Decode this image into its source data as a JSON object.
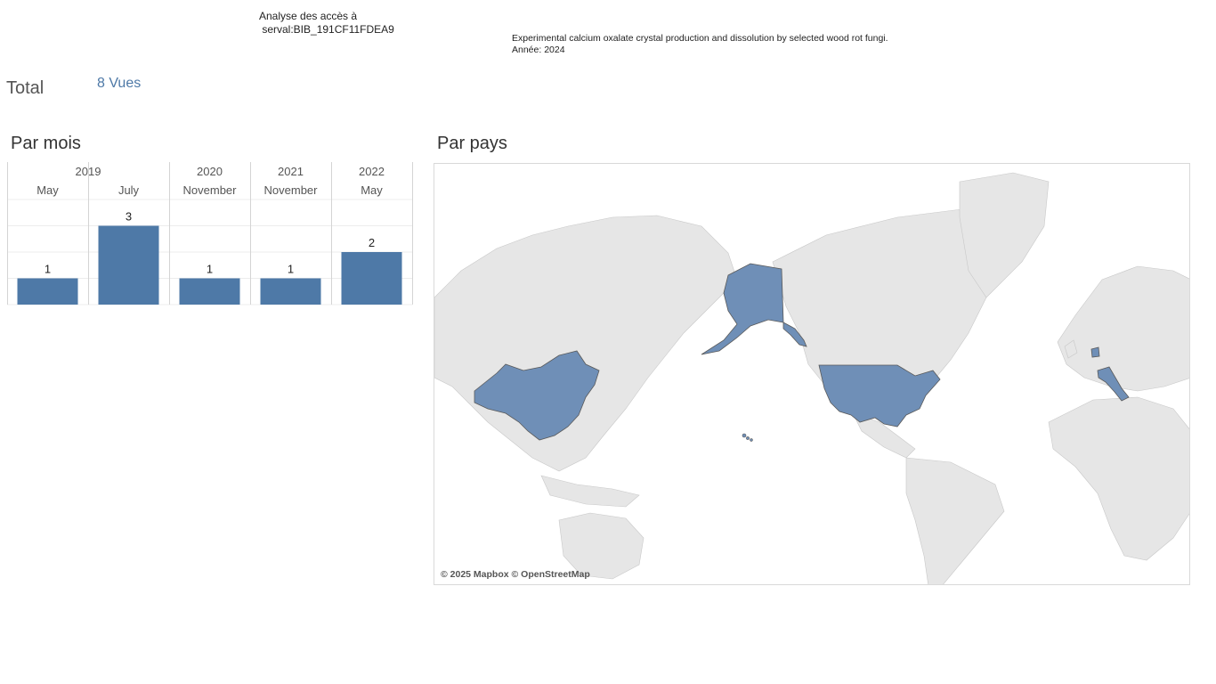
{
  "header": {
    "title": "Analyse des accès à\n serval:BIB_191CF11FDEA9",
    "publication": "Experimental calcium oxalate crystal production and dissolution by selected wood rot fungi.",
    "year_line": "Année: 2024"
  },
  "total": {
    "label": "Total",
    "value": "8 Vues"
  },
  "sections": {
    "by_month": "Par mois",
    "by_country": "Par pays"
  },
  "chart_data": {
    "type": "bar",
    "years": [
      {
        "label": "2019",
        "span": 2
      },
      {
        "label": "2020",
        "span": 1
      },
      {
        "label": "2021",
        "span": 1
      },
      {
        "label": "2022",
        "span": 1
      }
    ],
    "categories": [
      "May",
      "July",
      "November",
      "November",
      "May"
    ],
    "values": [
      1,
      3,
      1,
      1,
      2
    ],
    "ylim": [
      0,
      4
    ],
    "grid": true,
    "color": "#4e79a7"
  },
  "map": {
    "attribution": "© 2025 Mapbox © OpenStreetMap",
    "highlighted_countries": [
      "China",
      "United States",
      "Italy",
      "Netherlands"
    ],
    "highlight_color": "#6f8fb7",
    "land_color": "#e6e6e6"
  }
}
